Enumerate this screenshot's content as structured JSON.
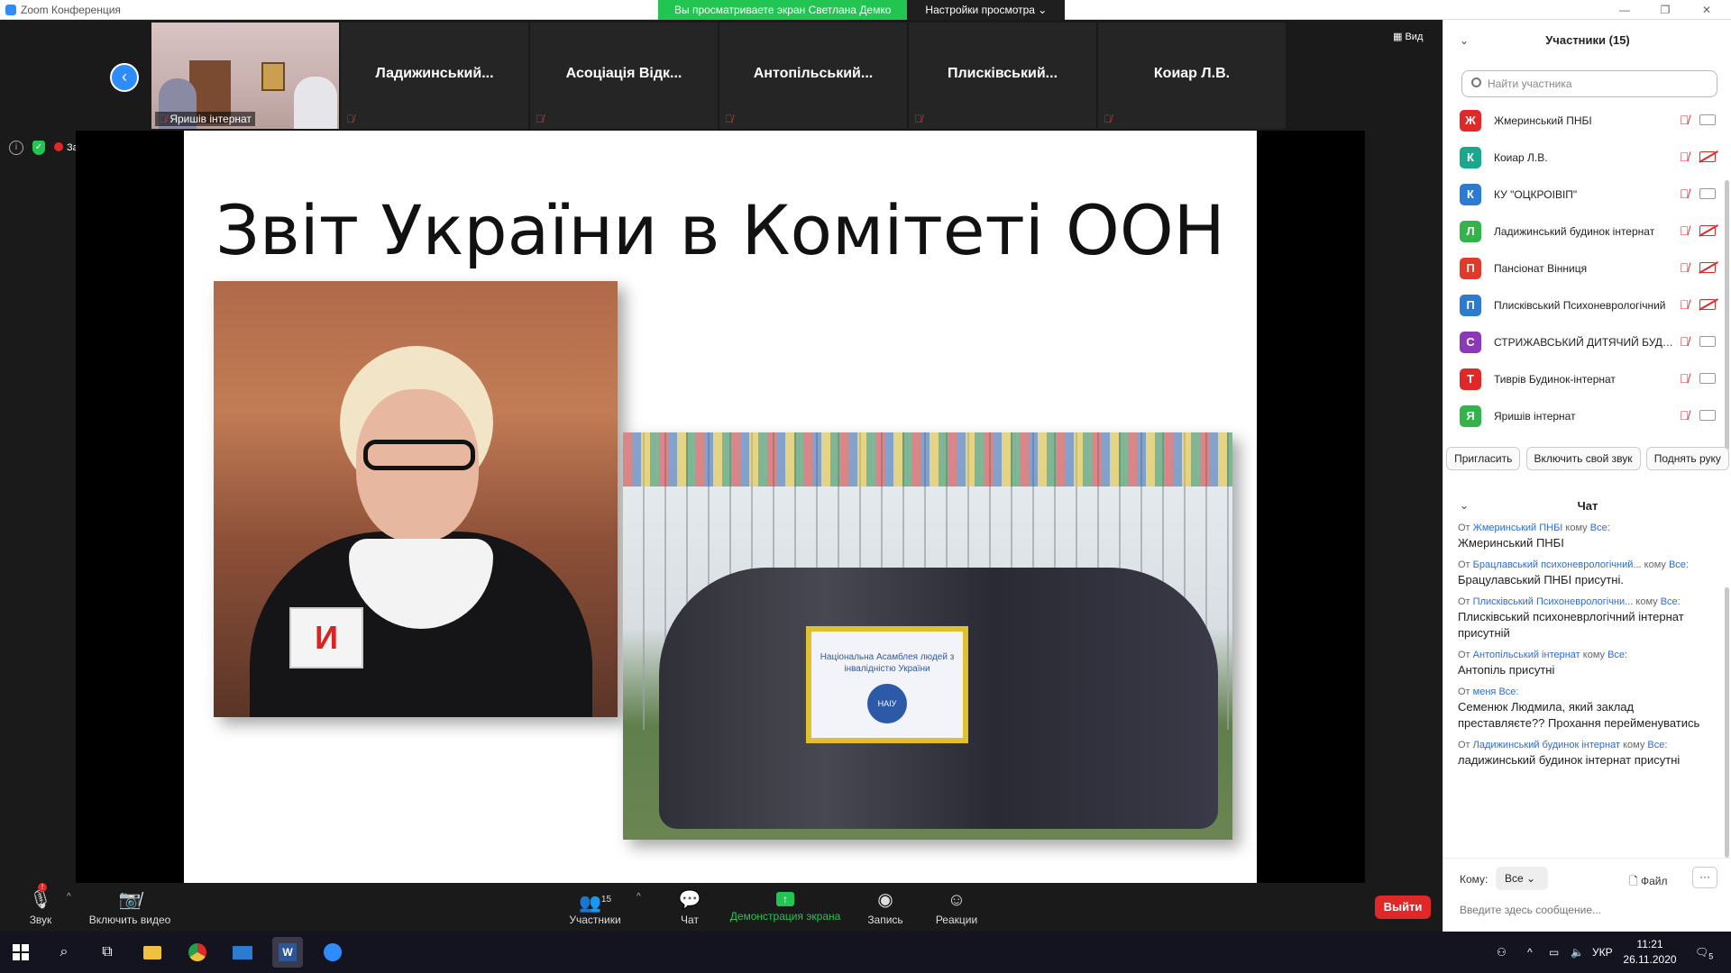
{
  "window": {
    "title": "Zoom Конференция",
    "controls": [
      "—",
      "❐",
      "✕"
    ]
  },
  "share_banner": {
    "viewing": "Вы просматриваете экран Светлана Демко",
    "view_settings": "Настройки просмотра ⌄"
  },
  "thumbnails": [
    {
      "name": "Яришів інтернат",
      "type": "video"
    },
    {
      "name": "Ладижинський..."
    },
    {
      "name": "Асоціація Відк..."
    },
    {
      "name": "Антопільський..."
    },
    {
      "name": "Плисківський..."
    },
    {
      "name": "Коиар Л.В."
    }
  ],
  "view_button": "Вид",
  "recording_label": "Запись",
  "slide": {
    "title": "Звіт України в Комітеті ООН",
    "badge_letter": "И",
    "banner_text": "Національна Асамблея людей з інвалідністю України",
    "banner_logo": "НАІУ"
  },
  "toolbar": {
    "audio": "Звук",
    "video": "Включить видео",
    "participants": "Участники",
    "participants_count": "15",
    "chat": "Чат",
    "share": "Демонстрация экрана",
    "record": "Запись",
    "reactions": "Реакции",
    "leave": "Выйти",
    "audio_badge": "!"
  },
  "participants_panel": {
    "title": "Участники (15)",
    "search_placeholder": "Найти участника",
    "list": [
      {
        "initial": "Ж",
        "name": "Жмеринський ПНБІ",
        "color": "#e02828",
        "cam_off": false
      },
      {
        "initial": "К",
        "name": "Коиар Л.В.",
        "color": "#1aa88a",
        "cam_off": true
      },
      {
        "initial": "К",
        "name": "КУ \"ОЦКРОІВІП\"",
        "color": "#2d7bd0",
        "cam_off": false
      },
      {
        "initial": "Л",
        "name": "Ладижинський будинок інтернат",
        "color": "#33b34a",
        "cam_off": true
      },
      {
        "initial": "П",
        "name": "Пансіонат Вінниця",
        "color": "#e03a2a",
        "cam_off": true
      },
      {
        "initial": "П",
        "name": "Плисківський Психоневрологічний",
        "color": "#2d7bd0",
        "cam_off": true
      },
      {
        "initial": "С",
        "name": "СТРИЖАВСЬКИЙ ДИТЯЧИЙ БУДИНОК",
        "color": "#8a3ab8",
        "cam_off": false
      },
      {
        "initial": "Т",
        "name": "Тиврів Будинок-інтернат",
        "color": "#e02828",
        "cam_off": false
      },
      {
        "initial": "Я",
        "name": "Яришів інтернат",
        "color": "#33b34a",
        "cam_off": false
      }
    ],
    "actions": [
      "Пригласить",
      "Включить свой звук",
      "Поднять руку"
    ]
  },
  "chat": {
    "title": "Чат",
    "from_word": "От",
    "to_word": "кому",
    "messages": [
      {
        "from": "Жмеринський ПНБІ",
        "to": "Все:",
        "text": "Жмеринський ПНБІ"
      },
      {
        "from": "Брацлавський психоневрологічний...",
        "to": "Все:",
        "text": "Брацулавський ПНБІ присутні."
      },
      {
        "from": "Плисківський Психоневрологічни...",
        "to": "Все:",
        "text": "Плисківський психоневрлогічний інтернат присутній"
      },
      {
        "from": "Антопільський інтернат",
        "to": "Все:",
        "text": "Антопіль присутні"
      },
      {
        "from": "меня",
        "to": "Все:",
        "text": "Семенюк Людмила, який заклад преставляєте?? Прохання перейменуватись",
        "self": true
      },
      {
        "from": "Ладижинський будинок інтернат",
        "to": "Все:",
        "text": "ладижинський будинок інтернат присутні"
      }
    ],
    "to_label": "Кому:",
    "to_value": "Все ⌄",
    "file_label": "Файл",
    "more_label": "···",
    "input_placeholder": "Введите здесь сообщение..."
  },
  "taskbar": {
    "apps": [
      "explorer",
      "chrome",
      "mail",
      "word",
      "zoom"
    ],
    "lang": "УКР",
    "time": "11:21",
    "date": "26.11.2020",
    "notifications": "5"
  }
}
